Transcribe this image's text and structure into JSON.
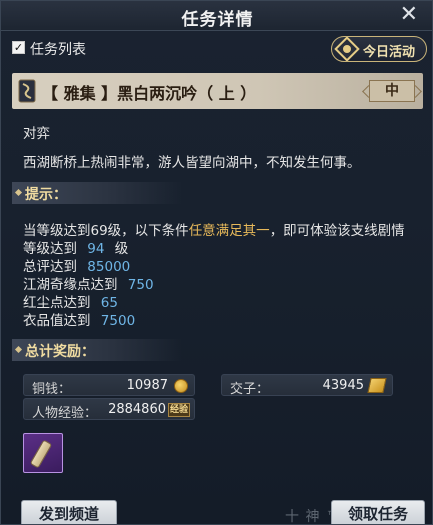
{
  "window": {
    "title": "任务详情",
    "close_symbol": "✕"
  },
  "top": {
    "checkbox_label": "任务列表",
    "checkbox_checked": true,
    "today_button_label": "今日活动"
  },
  "quest": {
    "title": "【 雅集 】黑白两沉吟（ 上 ）",
    "difficulty": "中"
  },
  "description": {
    "line1": "对弈",
    "line2": "西湖断桥上热闹非常，游人皆望向湖中，不知发生何事。"
  },
  "hints": {
    "heading": "提示：",
    "intro_prefix": "当等级达到69级，以下条件",
    "intro_highlight": "任意满足其一",
    "intro_suffix": "，即可体验该支线剧情",
    "conditions": [
      {
        "label": "等级达到",
        "value": "94",
        "suffix": "级"
      },
      {
        "label": "总评达到",
        "value": "85000",
        "suffix": ""
      },
      {
        "label": "江湖奇缘点达到",
        "value": "750",
        "suffix": ""
      },
      {
        "label": "红尘点达到",
        "value": "65",
        "suffix": ""
      },
      {
        "label": "衣品值达到",
        "value": "7500",
        "suffix": ""
      }
    ]
  },
  "rewards": {
    "heading": "总计奖励：",
    "copper_label": "铜钱：",
    "copper_value": "10987",
    "jiaozi_label": "交子：",
    "jiaozi_value": "43945",
    "exp_label": "人物经验：",
    "exp_value": "2884860",
    "exp_icon_text": "经验",
    "colors": {
      "accent": "#f0dca1",
      "value_blue": "#6fb5e6",
      "highlight": "#e6b85a"
    }
  },
  "buttons": {
    "channel": "发到频道",
    "accept": "领取任务"
  },
  "watermark": "十 神  ™荒"
}
